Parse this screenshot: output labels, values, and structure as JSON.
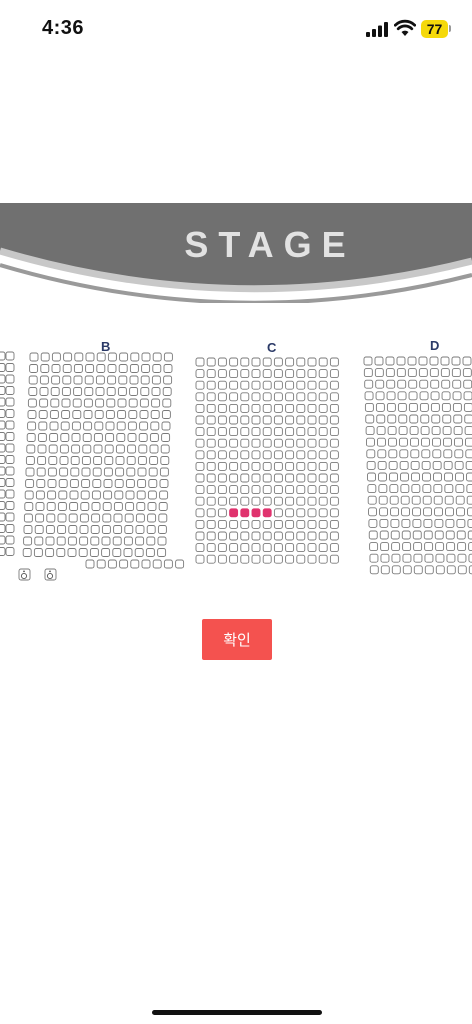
{
  "status_bar": {
    "time": "4:36",
    "battery_level": "77"
  },
  "stage": {
    "label": "STAGE"
  },
  "sections": [
    "B",
    "C",
    "D"
  ],
  "selected_seat": {
    "section": "C",
    "row": 14,
    "seats": [
      4,
      5,
      6,
      7
    ]
  },
  "confirm_button": {
    "label": "확인"
  },
  "colors": {
    "stage_band": "#707070",
    "stage_arc": "#c8c8c8",
    "seat_outline": "#7a7a7a",
    "selected_seat": "#e0336e",
    "confirm_button": "#f4524f",
    "section_label": "#2b3a67",
    "battery": "#f5d90a"
  }
}
